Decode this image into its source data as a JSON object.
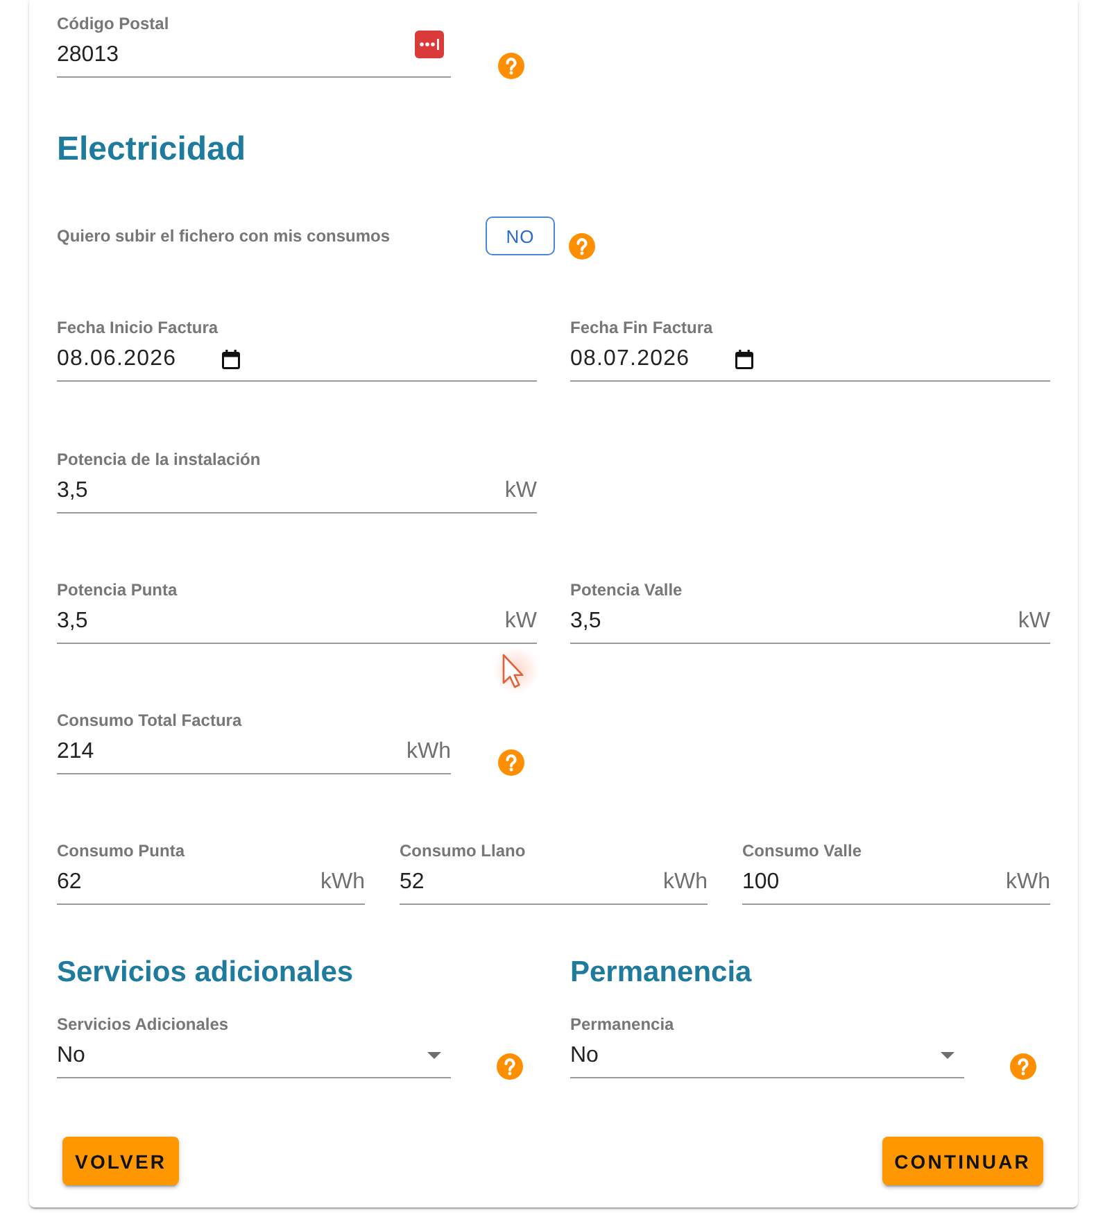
{
  "postal_code": {
    "label": "Código Postal",
    "value": "28013"
  },
  "electricity": {
    "title": "Electricidad",
    "upload_file": {
      "label": "Quiero subir el fichero con mis consumos",
      "button": "NO"
    },
    "invoice_start_date": {
      "label": "Fecha Inicio Factura",
      "value": "08.06.2026"
    },
    "invoice_end_date": {
      "label": "Fecha Fin Factura",
      "value": "08.07.2026"
    },
    "installed_power": {
      "label": "Potencia de la instalación",
      "value": "3,5",
      "unit": "kW"
    },
    "peak_power": {
      "label": "Potencia Punta",
      "value": "3,5",
      "unit": "kW"
    },
    "valley_power": {
      "label": "Potencia Valle",
      "value": "3,5",
      "unit": "kW"
    },
    "total_consumption": {
      "label": "Consumo Total Factura",
      "value": "214",
      "unit": "kWh"
    },
    "consumption": [
      {
        "label": "Consumo Punta",
        "value": "62",
        "unit": "kWh"
      },
      {
        "label": "Consumo Llano",
        "value": "52",
        "unit": "kWh"
      },
      {
        "label": "Consumo Valle",
        "value": "100",
        "unit": "kWh"
      }
    ]
  },
  "additional_services": {
    "title": "Servicios adicionales",
    "select": {
      "label": "Servicios Adicionales",
      "value": "No"
    }
  },
  "permanence": {
    "title": "Permanencia",
    "select": {
      "label": "Permanencia",
      "value": "No"
    }
  },
  "buttons": [
    "VOLVER",
    "CONTINUAR"
  ]
}
